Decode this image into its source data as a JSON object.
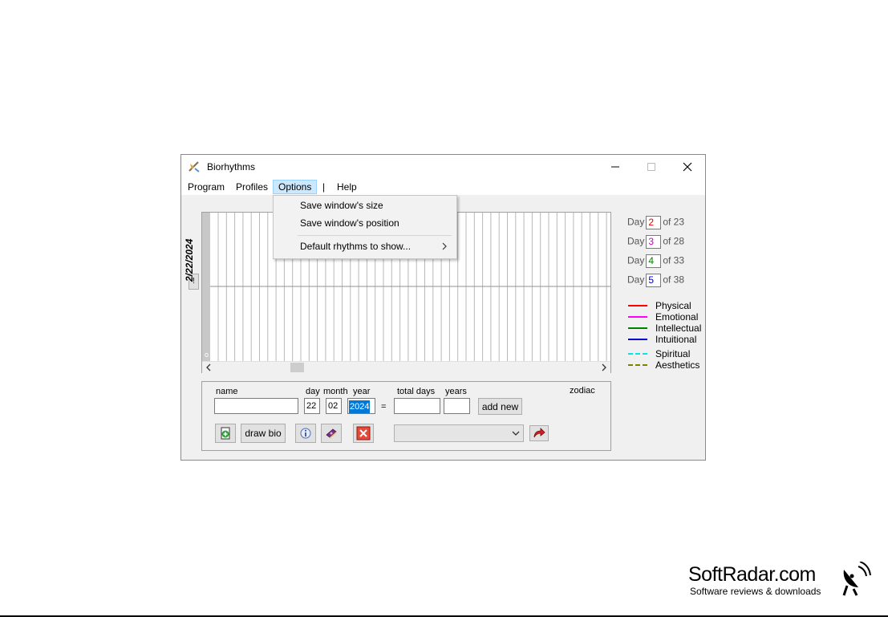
{
  "window": {
    "title": "Biorhythms",
    "menu": [
      "Program",
      "Profiles",
      "Options",
      "|",
      "Help"
    ]
  },
  "options_menu": {
    "items": [
      "Save window's size",
      "Save window's position",
      "Default rhythms to show..."
    ]
  },
  "chart": {
    "date_label": "2/22/2024",
    "side_button": "!",
    "corner_mark": "o"
  },
  "cycles": [
    {
      "prefix": "Day",
      "value": "2",
      "suffix": "of 23",
      "color": "#e00000"
    },
    {
      "prefix": "Day",
      "value": "3",
      "suffix": "of 28",
      "color": "#cc00cc"
    },
    {
      "prefix": "Day",
      "value": "4",
      "suffix": "of 33",
      "color": "#008000"
    },
    {
      "prefix": "Day",
      "value": "5",
      "suffix": "of 38",
      "color": "#0000cc"
    }
  ],
  "legend": [
    {
      "label": "Physical",
      "color": "#ff0000",
      "dashed": false
    },
    {
      "label": "Emotional",
      "color": "#ff00ff",
      "dashed": false
    },
    {
      "label": "Intellectual",
      "color": "#008000",
      "dashed": false
    },
    {
      "label": "Intuitional",
      "color": "#0000cc",
      "dashed": false
    },
    {
      "label": "Spiritual",
      "color": "#00e5ee",
      "dashed": true
    },
    {
      "label": "Aesthetics",
      "color": "#808000",
      "dashed": true
    }
  ],
  "form": {
    "name_label": "name",
    "day_label": "day",
    "month_label": "month",
    "year_label": "year",
    "total_days_label": "total days",
    "years_label": "years",
    "zodiac_label": "zodiac",
    "name_value": "",
    "day_value": "22",
    "month_value": "02",
    "year_value": "2024",
    "equals": "=",
    "total_days_value": "",
    "years_value": "",
    "add_new_label": "add new",
    "draw_bio_label": "draw bio",
    "profile_select_value": ""
  },
  "watermark": {
    "title": "SoftRadar.com",
    "subtitle": "Software reviews & downloads"
  }
}
